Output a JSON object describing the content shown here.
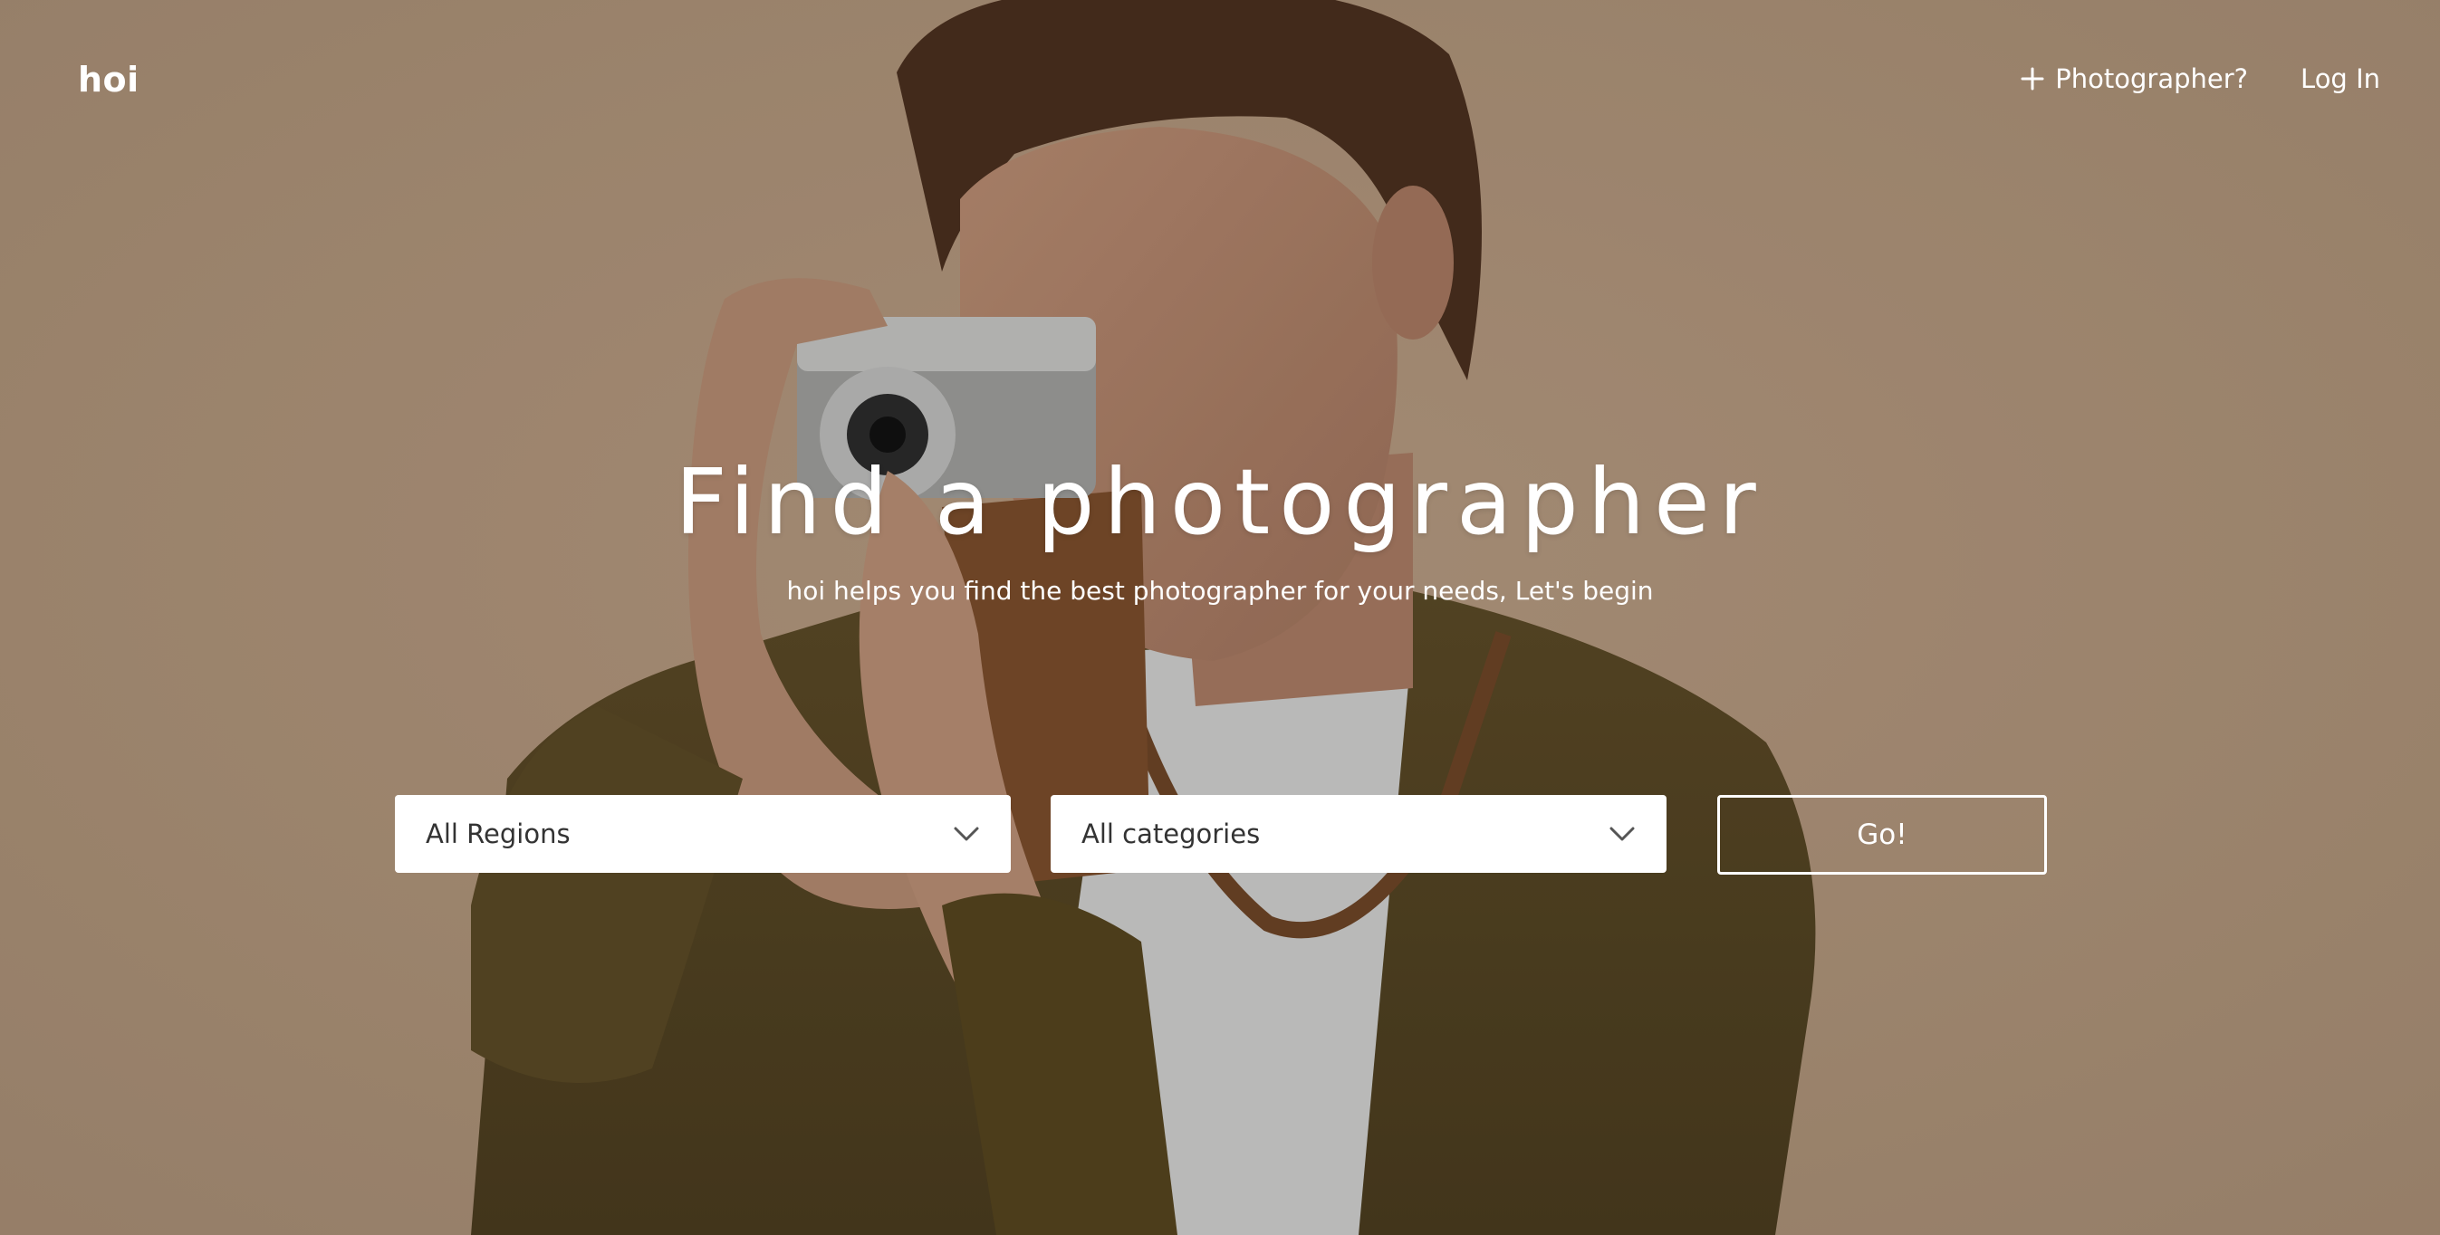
{
  "header": {
    "logo": "hoi",
    "nav": {
      "photographer_label": "Photographer?",
      "photographer_icon": "plus-icon",
      "login_label": "Log In"
    }
  },
  "hero": {
    "title": "Find a photographer",
    "subtitle": "hoi helps you find the best photographer for your needs, Let's begin"
  },
  "search": {
    "region_select": {
      "selected": "All Regions",
      "icon": "chevron-down-icon"
    },
    "category_select": {
      "selected": "All categories",
      "icon": "chevron-down-icon"
    },
    "submit_label": "Go!"
  },
  "colors": {
    "background": "#a98f77",
    "text": "#ffffff",
    "select_bg": "#ffffff",
    "select_text": "#333333"
  }
}
